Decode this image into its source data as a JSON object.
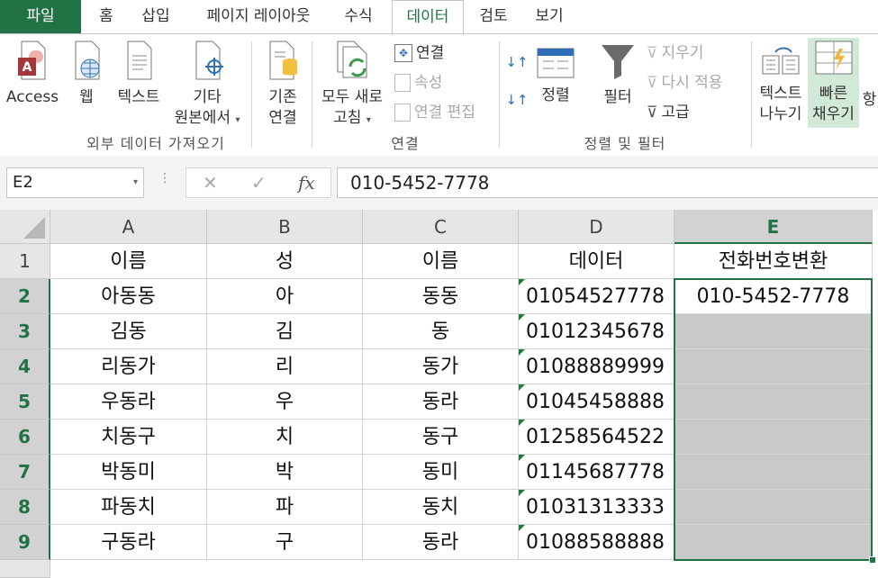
{
  "tabs": [
    "파일",
    "홈",
    "삽입",
    "페이지 레이아웃",
    "수식",
    "데이터",
    "검토",
    "보기"
  ],
  "ribbon": {
    "external": {
      "access": "Access",
      "web": "웹",
      "text": "텍스트",
      "other_l1": "기타",
      "other_l2": "원본에서",
      "existing_l1": "기존",
      "existing_l2": "연결",
      "group": "외부 데이터 가져오기"
    },
    "connections": {
      "refresh_l1": "모두 새로",
      "refresh_l2": "고침",
      "connections": "연결",
      "properties": "속성",
      "edit_links": "연결 편집",
      "group": "연결"
    },
    "sortfilter": {
      "sort": "정렬",
      "filter": "필터",
      "clear": "지우기",
      "reapply": "다시 적용",
      "advanced": "고급",
      "group": "정렬 및 필터"
    },
    "tools": {
      "text_to_cols_l1": "텍스트",
      "text_to_cols_l2": "나누기",
      "flash_l1": "빠른",
      "flash_l2": "채우기"
    }
  },
  "formula_bar": {
    "name_box": "E2",
    "formula": "010-5452-7778"
  },
  "sheet": {
    "columns": [
      "A",
      "B",
      "C",
      "D",
      "E"
    ],
    "rows": [
      "1",
      "2",
      "3",
      "4",
      "5",
      "6",
      "7",
      "8",
      "9"
    ],
    "header": [
      "이름",
      "성",
      "이름",
      "데이터",
      "전화번호변환"
    ],
    "data": [
      [
        "아동동",
        "아",
        "동동",
        "01054527778",
        "010-5452-7778"
      ],
      [
        "김동",
        "김",
        "동",
        "01012345678",
        ""
      ],
      [
        "리동가",
        "리",
        "동가",
        "01088889999",
        ""
      ],
      [
        "우동라",
        "우",
        "동라",
        "01045458888",
        ""
      ],
      [
        "치동구",
        "치",
        "동구",
        "01258564522",
        ""
      ],
      [
        "박동미",
        "박",
        "동미",
        "01145687778",
        ""
      ],
      [
        "파동치",
        "파",
        "동치",
        "01031313333",
        ""
      ],
      [
        "구동라",
        "구",
        "동라",
        "01088588888",
        ""
      ]
    ]
  },
  "colors": {
    "accent": "#217346",
    "selection_fill": "#c9c9c9"
  }
}
